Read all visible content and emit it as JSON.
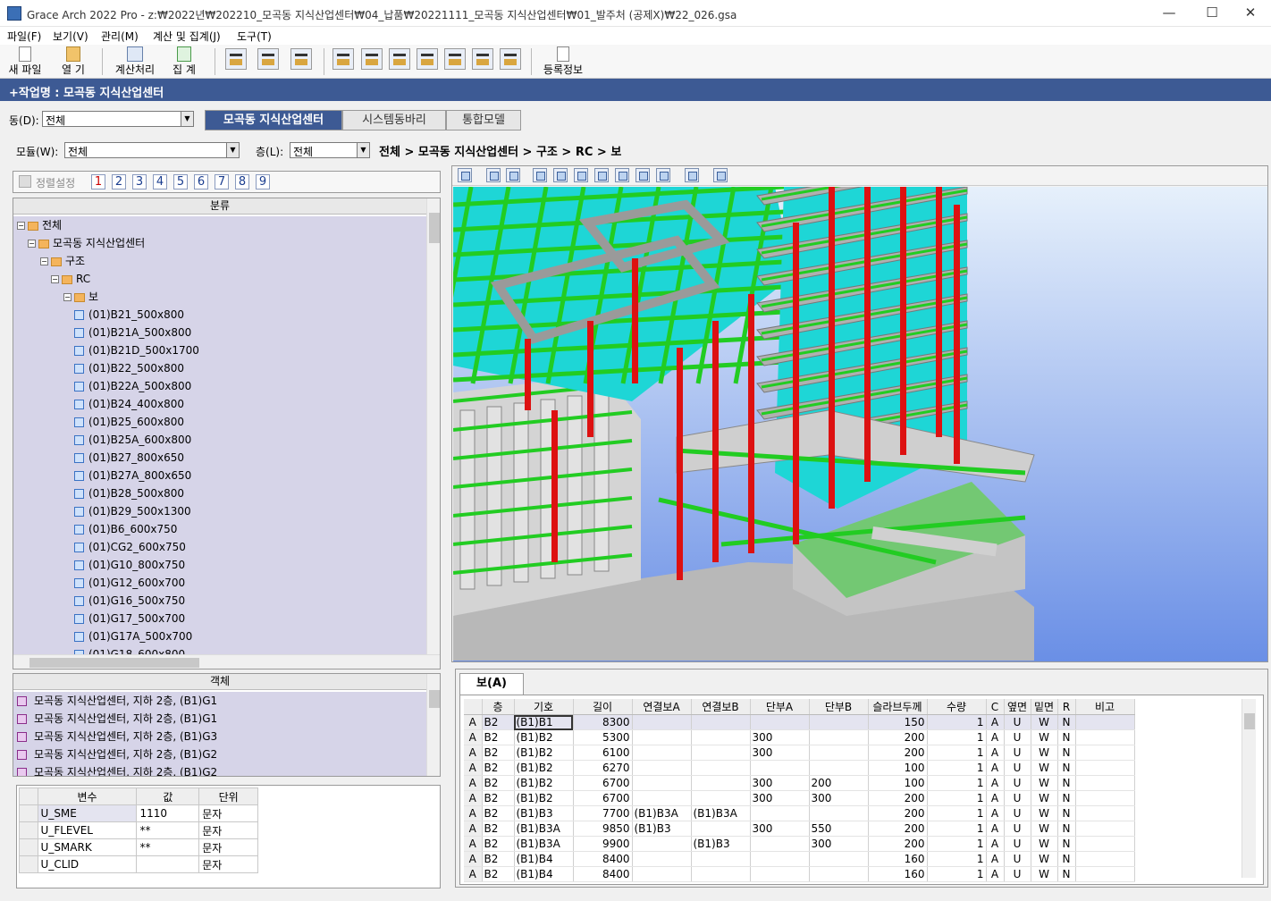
{
  "window": {
    "title": "Grace Arch 2022 Pro - z:₩2022년₩202210_모곡동 지식산업센터₩04_납품₩20221111_모곡동 지식산업센터₩01_발주처 (공제X)₩22_026.gsa",
    "minimize": "—",
    "maximize": "☐",
    "close": "✕"
  },
  "menu": [
    "파일(F)",
    "보기(V)",
    "관리(M)",
    "계산 및 집계(J)",
    "도구(T)"
  ],
  "toolbar": {
    "new": "새 파일",
    "open": "열 기",
    "calc": "계산처리",
    "total": "집 계",
    "reg": "등록정보"
  },
  "job": "+작업명 : 모곡동 지식산업센터",
  "dong": {
    "label": "동(D):",
    "value": "전체"
  },
  "tabs": [
    "모곡동 지식산업센터",
    "시스템동바리",
    "통합모델"
  ],
  "module": {
    "label": "모듈(W):",
    "value": "전체"
  },
  "floor": {
    "label": "층(L):",
    "value": "전체"
  },
  "breadcrumb": "전체 > 모곡동 지식산업센터 > 구조 > RC > 보",
  "sort": {
    "label": "정렬설정",
    "nums": [
      "1",
      "2",
      "3",
      "4",
      "5",
      "6",
      "7",
      "8",
      "9"
    ]
  },
  "tree": {
    "header": "분류",
    "root": "전체",
    "site": "모곡동 지식산업센터",
    "struct": "구조",
    "rc": "RC",
    "beam": "보",
    "items": [
      "(01)B21_500x800",
      "(01)B21A_500x800",
      "(01)B21D_500x1700",
      "(01)B22_500x800",
      "(01)B22A_500x800",
      "(01)B24_400x800",
      "(01)B25_600x800",
      "(01)B25A_600x800",
      "(01)B27_800x650",
      "(01)B27A_800x650",
      "(01)B28_500x800",
      "(01)B29_500x1300",
      "(01)B6_600x750",
      "(01)CG2_600x750",
      "(01)G10_800x750",
      "(01)G12_600x700",
      "(01)G16_500x750",
      "(01)G17_500x700",
      "(01)G17A_500x700",
      "(01)G18_600x800"
    ]
  },
  "objects": {
    "header": "객체",
    "items": [
      "모곡동 지식산업센터, 지하 2층, (B1)G1",
      "모곡동 지식산업센터, 지하 2층, (B1)G1",
      "모곡동 지식산업센터, 지하 2층, (B1)G3",
      "모곡동 지식산업센터, 지하 2층, (B1)G2",
      "모곡동 지식산업센터, 지하 2층, (B1)G2"
    ]
  },
  "vars": {
    "headers": [
      "변수",
      "값",
      "단위"
    ],
    "rows": [
      [
        "U_SME",
        "1110",
        "문자"
      ],
      [
        "U_FLEVEL",
        "**",
        "문자"
      ],
      [
        "U_SMARK",
        "**",
        "문자"
      ],
      [
        "U_CLID",
        "",
        "문자"
      ]
    ]
  },
  "grid": {
    "tab": "보(A)",
    "headers": [
      "층",
      "기호",
      "길이",
      "연결보A",
      "연결보B",
      "단부A",
      "단부B",
      "슬라브두께",
      "수량",
      "C",
      "옆면",
      "밑면",
      "R",
      "비고"
    ],
    "rows": [
      [
        "A",
        "B2",
        "(B1)B1",
        "8300",
        "",
        "",
        "",
        "",
        "150",
        "1",
        "A",
        "U",
        "W",
        "N",
        ""
      ],
      [
        "A",
        "B2",
        "(B1)B2",
        "5300",
        "",
        "",
        "300",
        "",
        "200",
        "1",
        "A",
        "U",
        "W",
        "N",
        ""
      ],
      [
        "A",
        "B2",
        "(B1)B2",
        "6100",
        "",
        "",
        "300",
        "",
        "200",
        "1",
        "A",
        "U",
        "W",
        "N",
        ""
      ],
      [
        "A",
        "B2",
        "(B1)B2",
        "6270",
        "",
        "",
        "",
        "",
        "100",
        "1",
        "A",
        "U",
        "W",
        "N",
        ""
      ],
      [
        "A",
        "B2",
        "(B1)B2",
        "6700",
        "",
        "",
        "300",
        "200",
        "100",
        "1",
        "A",
        "U",
        "W",
        "N",
        ""
      ],
      [
        "A",
        "B2",
        "(B1)B2",
        "6700",
        "",
        "",
        "300",
        "300",
        "200",
        "1",
        "A",
        "U",
        "W",
        "N",
        ""
      ],
      [
        "A",
        "B2",
        "(B1)B3",
        "7700",
        "(B1)B3A",
        "(B1)B3A",
        "",
        "",
        "200",
        "1",
        "A",
        "U",
        "W",
        "N",
        ""
      ],
      [
        "A",
        "B2",
        "(B1)B3A",
        "9850",
        "(B1)B3",
        "",
        "300",
        "550",
        "200",
        "1",
        "A",
        "U",
        "W",
        "N",
        ""
      ],
      [
        "A",
        "B2",
        "(B1)B3A",
        "9900",
        "",
        "(B1)B3",
        "",
        "300",
        "200",
        "1",
        "A",
        "U",
        "W",
        "N",
        ""
      ],
      [
        "A",
        "B2",
        "(B1)B4",
        "8400",
        "",
        "",
        "",
        "",
        "160",
        "1",
        "A",
        "U",
        "W",
        "N",
        ""
      ],
      [
        "A",
        "B2",
        "(B1)B4",
        "8400",
        "",
        "",
        "",
        "",
        "160",
        "1",
        "A",
        "U",
        "W",
        "N",
        ""
      ]
    ]
  },
  "colors": {
    "slab": "#00e0e0",
    "beam": "#22cc22",
    "column": "#dd1111",
    "concrete": "#c8c8c8",
    "sky": "#6a8fe6"
  }
}
